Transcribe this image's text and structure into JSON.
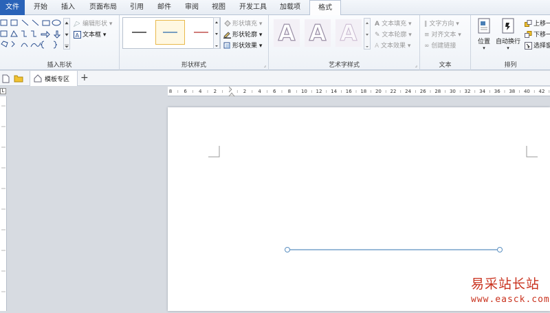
{
  "menu": {
    "tabs": [
      "文件",
      "开始",
      "插入",
      "页面布局",
      "引用",
      "邮件",
      "审阅",
      "视图",
      "开发工具",
      "加载项",
      "格式"
    ],
    "active_tab": "格式"
  },
  "ribbon": {
    "insert_shapes": {
      "label": "插入形状",
      "edit_shape": "编辑形状",
      "text_box": "文本框"
    },
    "shape_styles": {
      "label": "形状样式",
      "fill": "形状填充",
      "outline": "形状轮廓",
      "effects": "形状效果",
      "samples": [
        {
          "color": "#333333"
        },
        {
          "color": "#4a7fb5"
        },
        {
          "color": "#c0504d"
        }
      ]
    },
    "wordart": {
      "label": "艺术字样式",
      "letter": "A",
      "text_fill": "文本填充",
      "text_outline": "文本轮廓",
      "text_effects": "文本效果"
    },
    "text": {
      "label": "文本",
      "direction": "文字方向",
      "align": "对齐文本",
      "link": "创建链接"
    },
    "arrange": {
      "label": "排列",
      "position": "位置",
      "wrap": "自动换行",
      "bring_forward": "上移一",
      "send_backward": "下移一",
      "selection_pane": "选择窗"
    }
  },
  "doc_tabs": {
    "template_zone": "模板专区",
    "add": "+"
  },
  "ruler": {
    "labels": [
      "8",
      "6",
      "4",
      "2",
      "",
      "2",
      "4",
      "6",
      "8",
      "10",
      "12",
      "14",
      "16",
      "18",
      "20",
      "22",
      "24",
      "26",
      "28",
      "30",
      "32",
      "34",
      "36",
      "38",
      "40",
      "42"
    ]
  },
  "watermark": {
    "title": "易采站长站",
    "url": "www.easck.com"
  },
  "colors": {
    "accent": "#2a63b8",
    "line": "#5a8fc0",
    "watermark": "#c9321e"
  }
}
